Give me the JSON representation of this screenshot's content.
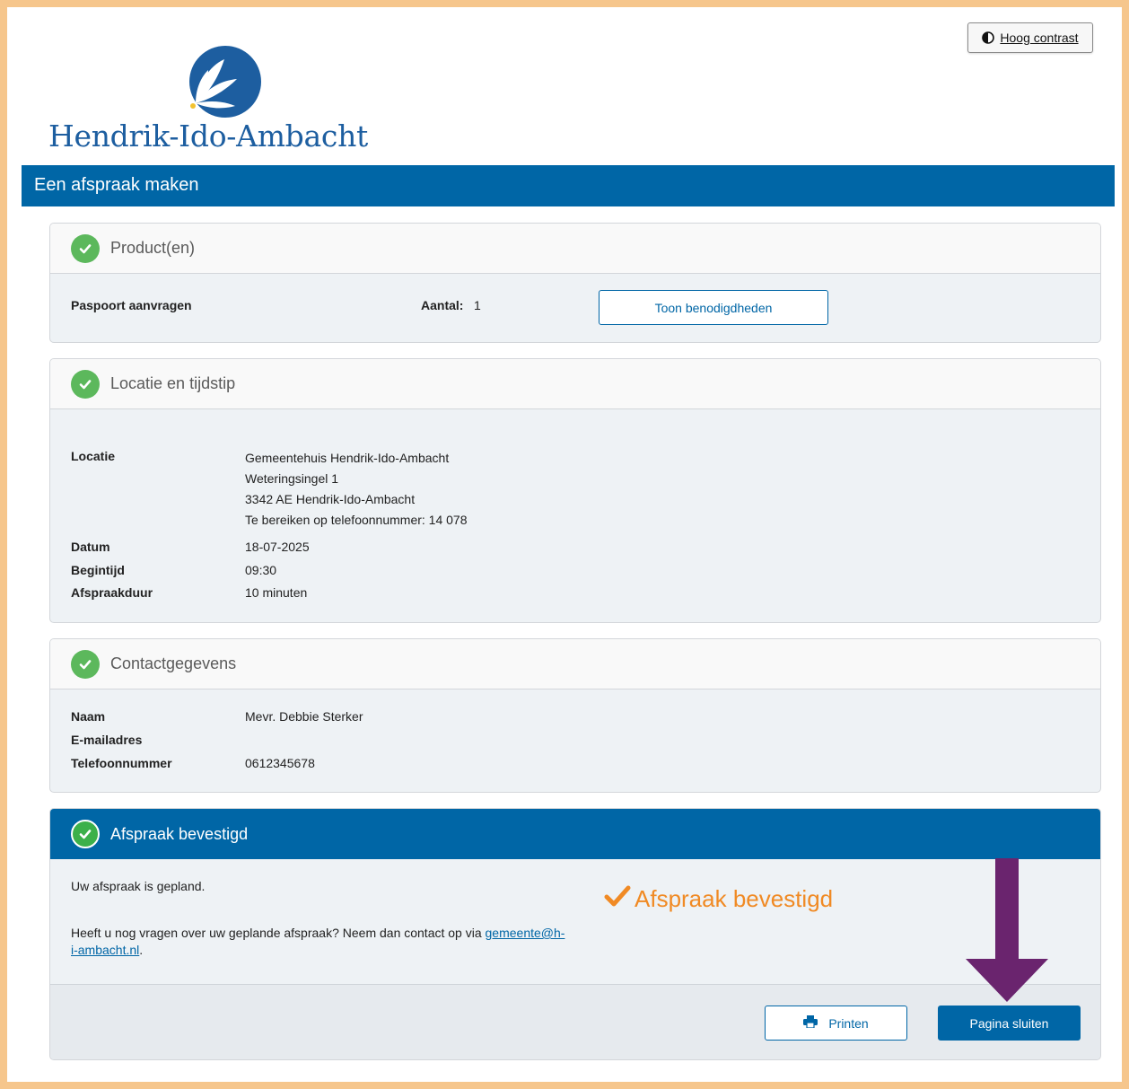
{
  "header": {
    "contrast_label": "Hoog contrast",
    "logo_text": "Hendrik-Ido-Ambacht",
    "page_title": "Een afspraak maken"
  },
  "colors": {
    "brand_blue": "#0066a6",
    "success_green": "#5cb85c",
    "confirm_orange": "#f08a24",
    "arrow_purple": "#6a246e",
    "frame_border": "#f6c68c"
  },
  "products": {
    "heading": "Product(en)",
    "item_name": "Paspoort aanvragen",
    "quantity_label": "Aantal:",
    "quantity_value": "1",
    "requirements_button": "Toon benodigdheden"
  },
  "location": {
    "heading": "Locatie en tijdstip",
    "location_label": "Locatie",
    "location_lines": [
      "Gemeentehuis Hendrik-Ido-Ambacht",
      "Weteringsingel 1",
      "3342 AE Hendrik-Ido-Ambacht",
      "Te bereiken op telefoonnummer: 14 078"
    ],
    "date_label": "Datum",
    "date_value": "18-07-2025",
    "start_label": "Begintijd",
    "start_value": "09:30",
    "duration_label": "Afspraakduur",
    "duration_value": "10 minuten"
  },
  "contact": {
    "heading": "Contactgegevens",
    "name_label": "Naam",
    "name_value": "Mevr. Debbie Sterker",
    "email_label": "E-mailadres",
    "email_value": "",
    "phone_label": "Telefoonnummer",
    "phone_value": "0612345678"
  },
  "confirmation": {
    "heading": "Afspraak bevestigd",
    "planned_text": "Uw afspraak is gepland.",
    "questions_text": "Heeft u nog vragen over uw geplande afspraak? Neem dan contact op via ",
    "email_link_line1": "gemeente@h-",
    "email_link_line2": "i-ambacht.nl",
    "questions_end": ".",
    "stamp_text": "Afspraak bevestigd",
    "print_button": "Printen",
    "close_button": "Pagina sluiten"
  }
}
